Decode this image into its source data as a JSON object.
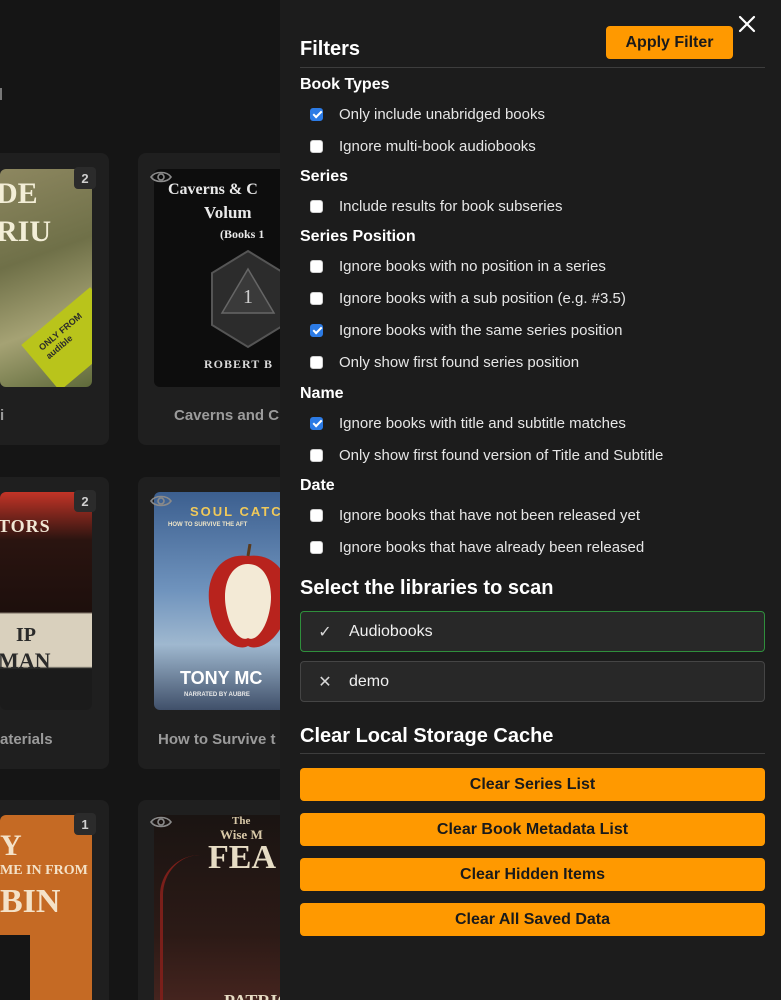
{
  "drawer": {
    "title": "Filters",
    "apply_label": "Apply Filter",
    "close_icon": "close-icon",
    "groups": [
      {
        "label": "Book Types",
        "options": [
          {
            "label": "Only include unabridged books",
            "checked": true
          },
          {
            "label": "Ignore multi-book audiobooks",
            "checked": false
          }
        ]
      },
      {
        "label": "Series",
        "options": [
          {
            "label": "Include results for book subseries",
            "checked": false
          }
        ]
      },
      {
        "label": "Series Position",
        "options": [
          {
            "label": "Ignore books with no position in a series",
            "checked": false
          },
          {
            "label": "Ignore books with a sub position (e.g. #3.5)",
            "checked": false
          },
          {
            "label": "Ignore books with the same series position",
            "checked": true
          },
          {
            "label": "Only show first found series position",
            "checked": false
          }
        ]
      },
      {
        "label": "Name",
        "options": [
          {
            "label": "Ignore books with title and subtitle matches",
            "checked": true
          },
          {
            "label": "Only show first found version of Title and Subtitle",
            "checked": false
          }
        ]
      },
      {
        "label": "Date",
        "options": [
          {
            "label": "Ignore books that have not been released yet",
            "checked": false
          },
          {
            "label": "Ignore books that have already been released",
            "checked": false
          }
        ]
      }
    ],
    "libraries_title": "Select the libraries to scan",
    "libraries": [
      {
        "label": "Audiobooks",
        "selected": true,
        "icon": "check-icon",
        "mark": "✓"
      },
      {
        "label": "demo",
        "selected": false,
        "icon": "x-icon",
        "mark": "✕"
      }
    ],
    "cache_title": "Clear Local Storage Cache",
    "cache_buttons": [
      "Clear Series List",
      "Clear Book Metadata List",
      "Clear Hidden Items",
      "Clear All Saved Data"
    ]
  },
  "background": {
    "rows": [
      {
        "left_badge": "2",
        "left_title": "i",
        "left_cover_text": [
          "DE",
          "RIU"
        ],
        "left_cover_sticker": "ONLY FROM audible",
        "right_title": "Caverns and C",
        "right_cover_text": [
          "Caverns & C",
          "Volum",
          "(Books 1",
          "ROBERT B"
        ]
      },
      {
        "left_badge": "2",
        "left_title": "aterials",
        "left_cover_text": [
          "TORS",
          "IP",
          "MAN"
        ],
        "right_title": "How to Survive t",
        "right_cover_text": [
          "SOUL CATC",
          "HOW TO SURVIVE THE AFT",
          "TONY MC",
          "NARRATED BY AUBRE"
        ]
      },
      {
        "left_badge": "1",
        "left_cover_text": [
          "Y",
          "ME IN FROM",
          "BIN"
        ],
        "right_cover_text": [
          "The",
          "Wise M",
          "FEA",
          "PATRIC"
        ]
      }
    ]
  },
  "colors": {
    "accent": "#ff9900",
    "checkbox_on": "#2c7be5",
    "library_selected_border": "#2f8f3c"
  }
}
